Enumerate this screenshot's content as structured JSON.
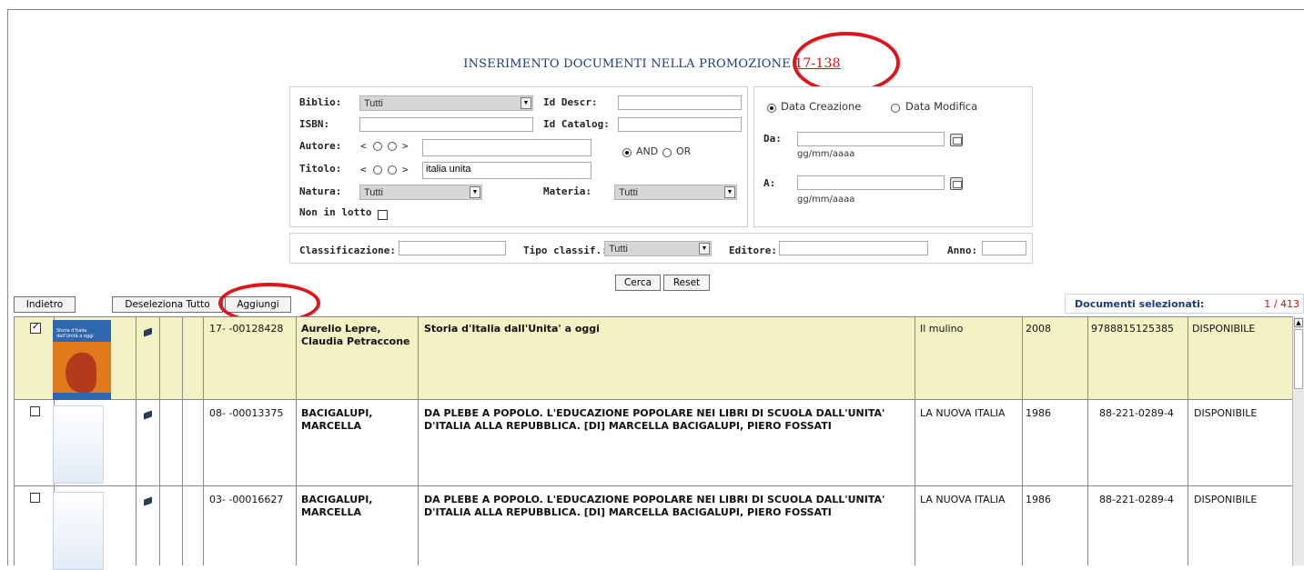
{
  "title": {
    "text": "INSERIMENTO DOCUMENTI NELLA PROMOZIONE",
    "code": "17-138"
  },
  "filters": {
    "biblio_label": "Biblio:",
    "biblio_value": "Tutti",
    "isbn_label": "ISBN:",
    "autore_label": "Autore:",
    "titolo_label": "Titolo:",
    "lt": "<",
    "gt": ">",
    "titolo_value": "italia unita",
    "natura_label": "Natura:",
    "natura_value": "Tutti",
    "materia_label": "Materia:",
    "materia_value": "Tutti",
    "non_in_lotto_label": "Non in lotto",
    "id_descr_label": "Id Descr:",
    "id_catalog_label": "Id Catalog:",
    "and_label": "AND",
    "or_label": "OR"
  },
  "date_panel": {
    "data_creazione": "Data Creazione",
    "data_modifica": "Data Modifica",
    "da_label": "Da:",
    "a_label": "A:",
    "format_hint": "gg/mm/aaaa"
  },
  "classif": {
    "classificazione_label": "Classificazione:",
    "tipo_label": "Tipo classif.:",
    "tipo_value": "Tutti",
    "editore_label": "Editore:",
    "anno_label": "Anno:"
  },
  "buttons": {
    "cerca": "Cerca",
    "reset": "Reset",
    "indietro": "Indietro",
    "deseleziona": "Deseleziona Tutto",
    "aggiungi": "Aggiungi"
  },
  "selected": {
    "label": "Documenti selezionati:",
    "count": "1 / 413"
  },
  "rows": [
    {
      "checked": true,
      "id": "17- -00128428",
      "author": "Aurelio Lepre, Claudia Petraccone",
      "title": "Storia d'Italia dall'Unita' a oggi",
      "publisher": "Il mulino",
      "year": "2008",
      "isbn": "9788815125385",
      "status": "DISPONIBILE",
      "cover_text": "Storia d'Italia dall'Unità a oggi"
    },
    {
      "checked": false,
      "id": "08- -00013375",
      "author": "BACIGALUPI, MARCELLA",
      "title": "DA PLEBE A POPOLO. L'EDUCAZIONE POPOLARE NEI LIBRI DI SCUOLA DALL'UNITA' D'ITALIA ALLA REPUBBLICA. [DI] MARCELLA BACIGALUPI, PIERO FOSSATI",
      "publisher": "LA NUOVA ITALIA",
      "year": "1986",
      "isbn": "88-221-0289-4",
      "status": "DISPONIBILE"
    },
    {
      "checked": false,
      "id": "03- -00016627",
      "author": "BACIGALUPI, MARCELLA",
      "title": "DA PLEBE A POPOLO. L'EDUCAZIONE POPOLARE NEI LIBRI DI SCUOLA DALL'UNITA' D'ITALIA ALLA REPUBBLICA. [DI] MARCELLA BACIGALUPI, PIERO FOSSATI",
      "publisher": "LA NUOVA ITALIA",
      "year": "1986",
      "isbn": "88-221-0289-4",
      "status": "DISPONIBILE"
    }
  ],
  "colors": {
    "highlight_row": "#f2f2c4",
    "title_blue": "#1f3b74",
    "annotation_red": "#e0141b",
    "code_red": "#cc1111"
  },
  "icons": [
    "book-icon",
    "calendar-icon",
    "dropdown-arrow-icon",
    "checkbox-icon"
  ]
}
